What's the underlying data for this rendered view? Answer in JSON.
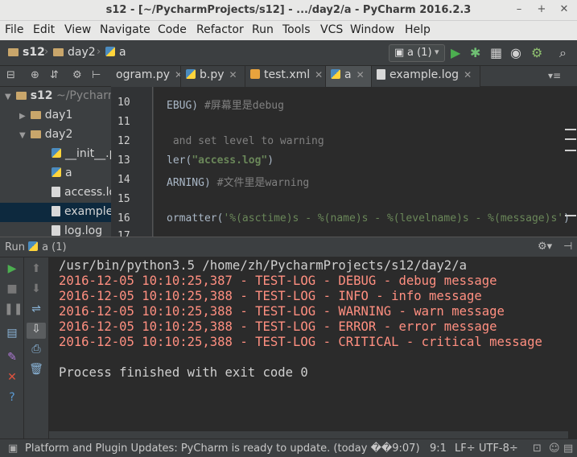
{
  "window": {
    "title": "s12 - [~/PycharmProjects/s12] - .../day2/a - PyCharm 2016.2.3"
  },
  "menu": [
    "File",
    "Edit",
    "View",
    "Navigate",
    "Code",
    "Refactor",
    "Run",
    "Tools",
    "VCS",
    "Window",
    "Help"
  ],
  "breadcrumb": {
    "project": "s12",
    "folder": "day2",
    "file": "a"
  },
  "run_config": "a (1)",
  "tabs": [
    {
      "label": "ogram.py",
      "icon": "python-file-icon"
    },
    {
      "label": "b.py",
      "icon": "python-file-icon"
    },
    {
      "label": "test.xml",
      "icon": "xml-file-icon"
    },
    {
      "label": "a",
      "icon": "python-file-icon",
      "active": true
    },
    {
      "label": "example.log",
      "icon": "log-file-icon"
    }
  ],
  "tree": {
    "root": "s12",
    "root_path": "~/Pycharm",
    "items": [
      "day1",
      "day2",
      "__init__.p",
      "a",
      "access.lo",
      "example",
      "log.log"
    ]
  },
  "editor": {
    "line_numbers": [
      "10",
      "11",
      "12",
      "13",
      "14",
      "15",
      "16",
      "17"
    ],
    "lines": {
      "l10_code": "EBUG) ",
      "l10_comment": "#屏幕里是debug",
      "l12": " and set level to warning",
      "l13_pre": "ler(",
      "l13_str": "\"access.log\"",
      "l13_post": ")",
      "l14_code": "ARNING) ",
      "l14_comment": "#文件里是warning",
      "l16_pre": "ormatter(",
      "l16_fmt": "'%(asctime)s - %(name)s - %(levelname)s - %(message)s'",
      "l16_post": ")"
    }
  },
  "run_panel": {
    "label": "Run",
    "config": "a (1)",
    "console": [
      "/usr/bin/python3.5 /home/zh/PycharmProjects/s12/day2/a",
      "2016-12-05 10:10:25,387 - TEST-LOG - DEBUG - debug message",
      "2016-12-05 10:10:25,388 - TEST-LOG - INFO - info message",
      "2016-12-05 10:10:25,388 - TEST-LOG - WARNING - warn message",
      "2016-12-05 10:10:25,388 - TEST-LOG - ERROR - error message",
      "2016-12-05 10:10:25,388 - TEST-LOG - CRITICAL - critical message",
      "",
      "Process finished with exit code 0"
    ]
  },
  "status": {
    "message": "Platform and Plugin Updates: PyCharm is ready to update. (today ��9:07)",
    "position": "9:1",
    "line_sep": "LF÷",
    "encoding": "UTF-8÷"
  },
  "colors": {
    "editor_bg": "#2b2b2b",
    "panel_bg": "#3c3f41",
    "error_text": "#ff8f80",
    "string": "#6a8759",
    "comment": "#808080"
  }
}
